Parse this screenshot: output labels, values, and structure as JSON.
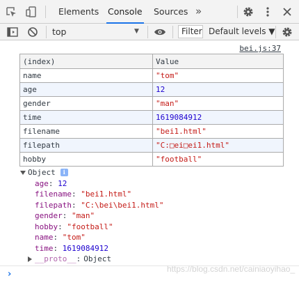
{
  "tabs": [
    {
      "label": "Elements"
    },
    {
      "label": "Console"
    },
    {
      "label": "Sources"
    }
  ],
  "more_tabs": "»",
  "toolbar": {
    "context": "top",
    "filter_placeholder": "Filter",
    "levels": "Default levels ▼"
  },
  "source_link": "bei.js:37",
  "table": {
    "headers": [
      "(index)",
      "Value"
    ],
    "rows": [
      {
        "index": "name",
        "value": "\"tom\""
      },
      {
        "index": "age",
        "value": "12"
      },
      {
        "index": "gender",
        "value": "\"man\""
      },
      {
        "index": "time",
        "value": "1619084912"
      },
      {
        "index": "filename",
        "value": "\"bei1.html\""
      },
      {
        "index": "filepath",
        "value": "\"C:□ei□ei1.html\""
      },
      {
        "index": "hobby",
        "value": "\"football\""
      }
    ]
  },
  "object": {
    "label": "Object",
    "info_icon": "i",
    "properties": [
      {
        "key": "age",
        "value": "12"
      },
      {
        "key": "filename",
        "value": "\"bei1.html\""
      },
      {
        "key": "filepath",
        "value": "\"C:\\bei\\bei1.html\""
      },
      {
        "key": "gender",
        "value": "\"man\""
      },
      {
        "key": "hobby",
        "value": "\"football\""
      },
      {
        "key": "name",
        "value": "\"tom\""
      },
      {
        "key": "time",
        "value": "1619084912"
      }
    ],
    "proto_key": "__proto__",
    "proto_value": "Object"
  },
  "prompt": "›",
  "watermark": "https://blog.csdn.net/cainiaoyihao_",
  "colors": {
    "string": "#c41a16",
    "number": "#1c00cf",
    "key": "#881280",
    "accent": "#1a73e8"
  }
}
